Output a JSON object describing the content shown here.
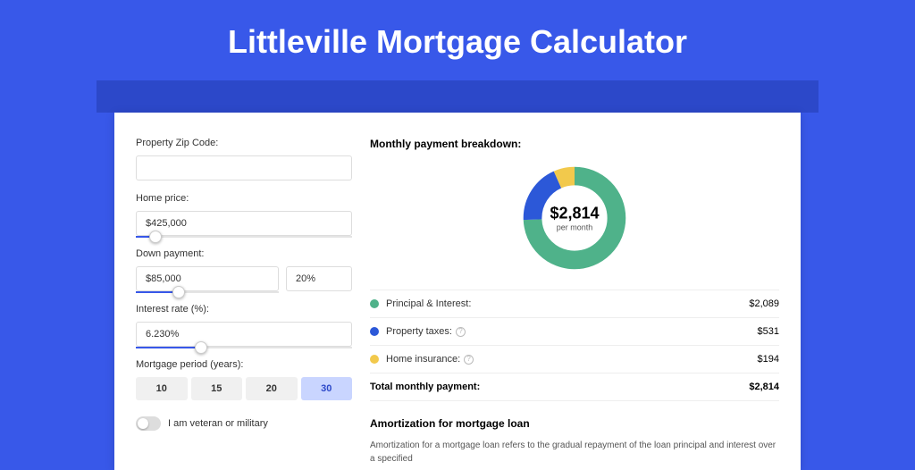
{
  "title": "Littleville Mortgage Calculator",
  "form": {
    "zip": {
      "label": "Property Zip Code:",
      "value": ""
    },
    "home_price": {
      "label": "Home price:",
      "value": "$425,000",
      "slider_pct": 9
    },
    "down_payment": {
      "label": "Down payment:",
      "amount": "$85,000",
      "pct": "20%",
      "slider_pct": 20
    },
    "interest": {
      "label": "Interest rate (%):",
      "value": "6.230%",
      "slider_pct": 30
    },
    "period": {
      "label": "Mortgage period (years):",
      "options": [
        "10",
        "15",
        "20",
        "30"
      ],
      "active": "30"
    },
    "veteran": {
      "label": "I am veteran or military",
      "on": false
    }
  },
  "breakdown": {
    "heading": "Monthly payment breakdown:",
    "center_amount": "$2,814",
    "center_sub": "per month",
    "items": [
      {
        "label": "Principal & Interest:",
        "value": "$2,089",
        "color": "#4fb28a",
        "info": false
      },
      {
        "label": "Property taxes:",
        "value": "$531",
        "color": "#2c58d8",
        "info": true
      },
      {
        "label": "Home insurance:",
        "value": "$194",
        "color": "#f2c94c",
        "info": true
      }
    ],
    "total": {
      "label": "Total monthly payment:",
      "value": "$2,814"
    }
  },
  "chart_data": {
    "type": "pie",
    "title": "Monthly payment breakdown",
    "series": [
      {
        "name": "Principal & Interest",
        "value": 2089,
        "color": "#4fb28a"
      },
      {
        "name": "Property taxes",
        "value": 531,
        "color": "#2c58d8"
      },
      {
        "name": "Home insurance",
        "value": 194,
        "color": "#f2c94c"
      }
    ],
    "total": 2814,
    "center_label": "$2,814 per month"
  },
  "amort": {
    "heading": "Amortization for mortgage loan",
    "text": "Amortization for a mortgage loan refers to the gradual repayment of the loan principal and interest over a specified"
  }
}
